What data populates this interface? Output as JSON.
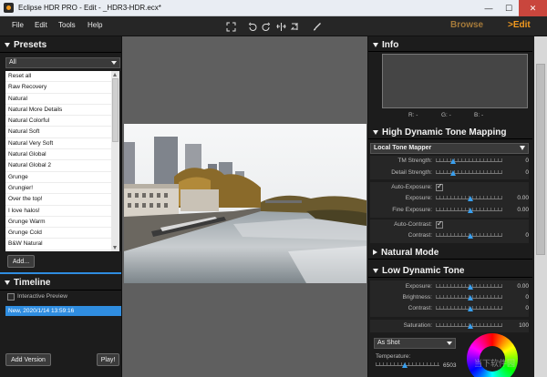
{
  "window": {
    "title": "Eclipse HDR PRO - Edit - _HDR3-HDR.ecx*",
    "min_glyph": "—",
    "max_glyph": "☐",
    "close_glyph": "✕"
  },
  "menu": {
    "items": [
      "File",
      "Edit",
      "Tools",
      "Help"
    ],
    "modes": {
      "browse": "Browse",
      "edit": ">Edit"
    },
    "tools": [
      "fit-screen-icon",
      "rotate-left-icon",
      "rotate-right-icon",
      "flip-icon",
      "flip-horizontal-icon",
      "brush-icon"
    ]
  },
  "presets": {
    "header": "Presets",
    "filter": "All",
    "items": [
      "Reset all",
      "Raw Recovery",
      "Natural",
      "Natural More Details",
      "Natural Colorful",
      "Natural Soft",
      "Natural Very Soft",
      "Natural Global",
      "Natural Global 2",
      "Grunge",
      "Grungier!",
      "Over the top!",
      "I love halos!",
      "Grunge Warm",
      "Grunge Cold",
      "B&W Natural"
    ],
    "add_label": "Add..."
  },
  "timeline": {
    "header": "Timeline",
    "interactive_preview": "Interactive Preview",
    "item": "New, 2020/1/14 13:59:16",
    "add_version": "Add Version",
    "play": "Play!"
  },
  "info": {
    "header": "Info",
    "r": "R: -",
    "g": "G: -",
    "b": "B: -"
  },
  "hdr_tone": {
    "header": "High Dynamic Tone Mapping",
    "mapper": "Local Tone Mapper",
    "tm_strength": {
      "label": "TM Strength:",
      "value": "0",
      "pos": 0.26
    },
    "detail_strength": {
      "label": "Detail Strength:",
      "value": "0",
      "pos": 0.26
    },
    "auto_exposure": {
      "label": "Auto-Exposure:",
      "checked": true
    },
    "exposure": {
      "label": "Exposure:",
      "value": "0.00",
      "pos": 0.52
    },
    "fine_exposure": {
      "label": "Fine Exposure:",
      "value": "0.00",
      "pos": 0.52
    },
    "auto_contrast": {
      "label": "Auto-Contrast:",
      "checked": true
    },
    "contrast": {
      "label": "Contrast:",
      "value": "0",
      "pos": 0.52
    }
  },
  "natural_mode": {
    "header": "Natural Mode"
  },
  "ldr_tone": {
    "header": "Low Dynamic Tone",
    "exposure": {
      "label": "Exposure:",
      "value": "0.00",
      "pos": 0.52
    },
    "brightness": {
      "label": "Brightness:",
      "value": "0",
      "pos": 0.52
    },
    "contrast": {
      "label": "Contrast:",
      "value": "0",
      "pos": 0.52
    },
    "saturation": {
      "label": "Saturation:",
      "value": "100",
      "pos": 0.52
    }
  },
  "white_balance": {
    "preset": "As Shot",
    "temperature": {
      "label": "Temperature:",
      "value": "6503",
      "pos": 0.45
    }
  },
  "watermark": "当下软件园"
}
